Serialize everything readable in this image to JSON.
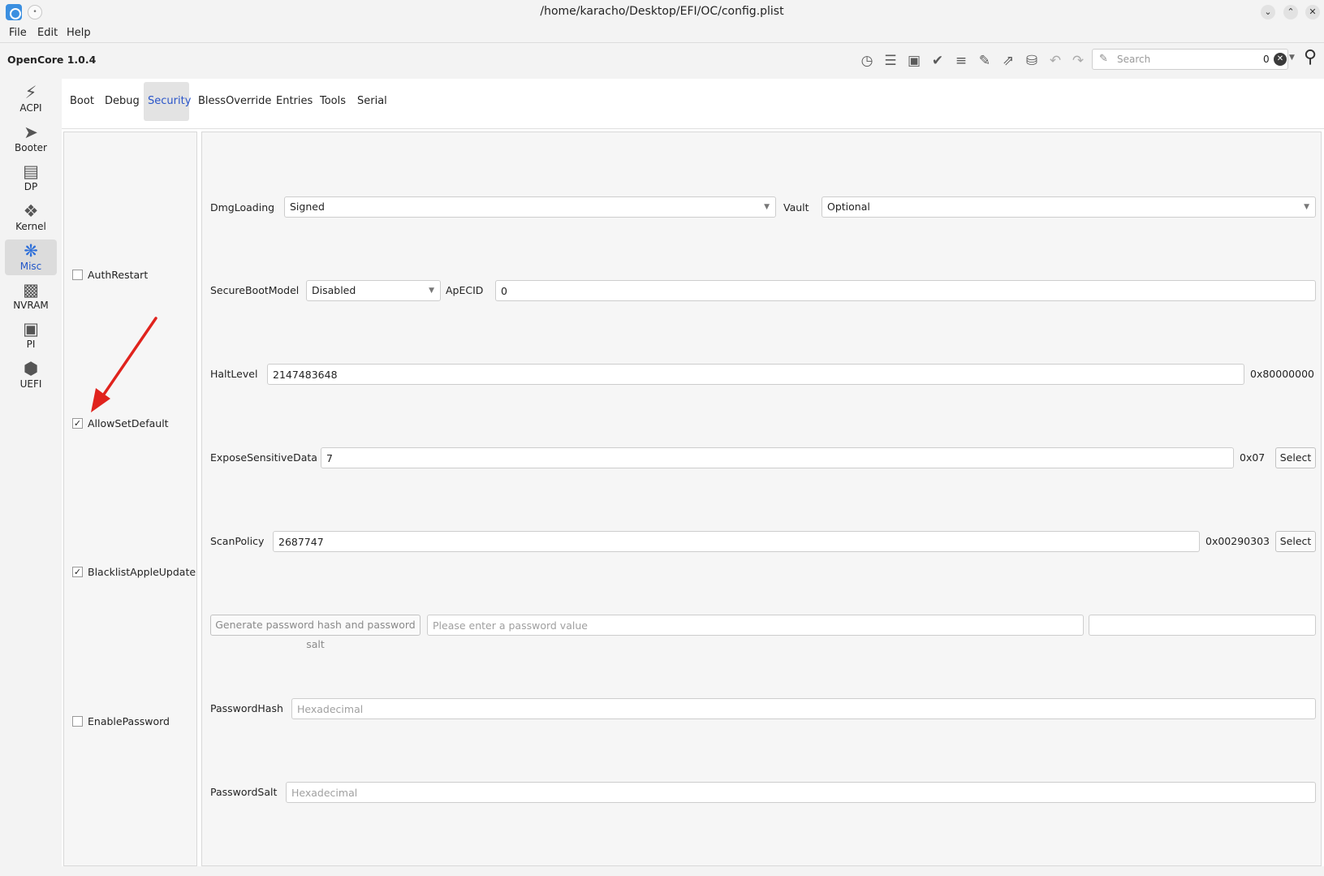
{
  "window": {
    "title": "/home/karacho/Desktop/EFI/OC/config.plist"
  },
  "menu": [
    "File",
    "Edit",
    "Help"
  ],
  "toolbar": {
    "version": "OpenCore 1.0.4",
    "icons": [
      "clock-icon",
      "list-icon",
      "save-icon",
      "check-circle-icon",
      "list-circle-icon",
      "edit-config-icon",
      "export-icon",
      "database-icon",
      "undo-icon",
      "redo-icon"
    ],
    "search": {
      "placeholder": "Search",
      "count": "0"
    }
  },
  "sidebar": [
    {
      "label": "ACPI",
      "icon": "lightning-icon"
    },
    {
      "label": "Booter",
      "icon": "rocket-icon"
    },
    {
      "label": "DP",
      "icon": "gpu-icon"
    },
    {
      "label": "Kernel",
      "icon": "kernel-icon"
    },
    {
      "label": "Misc",
      "icon": "cubes-icon",
      "active": true
    },
    {
      "label": "NVRAM",
      "icon": "chip-icon"
    },
    {
      "label": "PI",
      "icon": "apple-icon"
    },
    {
      "label": "UEFI",
      "icon": "box-icon"
    }
  ],
  "tabs": [
    "Boot",
    "Debug",
    "Security",
    "BlessOverride",
    "Entries",
    "Tools",
    "Serial"
  ],
  "active_tab": "Security",
  "checkboxes": [
    {
      "label": "AuthRestart",
      "checked": false
    },
    {
      "label": "AllowSetDefault",
      "checked": true
    },
    {
      "label": "BlacklistAppleUpdate",
      "checked": true
    },
    {
      "label": "EnablePassword",
      "checked": false
    }
  ],
  "checkmark": "✓",
  "form": {
    "dmgloading": {
      "label": "DmgLoading",
      "value": "Signed"
    },
    "vault": {
      "label": "Vault",
      "value": "Optional"
    },
    "secureboot": {
      "label": "SecureBootModel",
      "value": "Disabled"
    },
    "apecid": {
      "label": "ApECID",
      "value": "0"
    },
    "haltlevel": {
      "label": "HaltLevel",
      "value": "2147483648",
      "hex": "0x80000000"
    },
    "expose": {
      "label": "ExposeSensitiveData",
      "value": "7",
      "hex": "0x07",
      "button": "Select"
    },
    "scanpolicy": {
      "label": "ScanPolicy",
      "value": "2687747",
      "hex": "0x00290303",
      "button": "Select"
    },
    "password": {
      "button": "Generate password hash and password salt",
      "placeholder": "Please enter a password value",
      "output": ""
    },
    "passwordhash": {
      "label": "PasswordHash",
      "placeholder": "Hexadecimal"
    },
    "passwordsalt": {
      "label": "PasswordSalt",
      "placeholder": "Hexadecimal"
    }
  },
  "colors": {
    "accent": "#2a55c9",
    "annotation_arrow": "#e0231d"
  }
}
